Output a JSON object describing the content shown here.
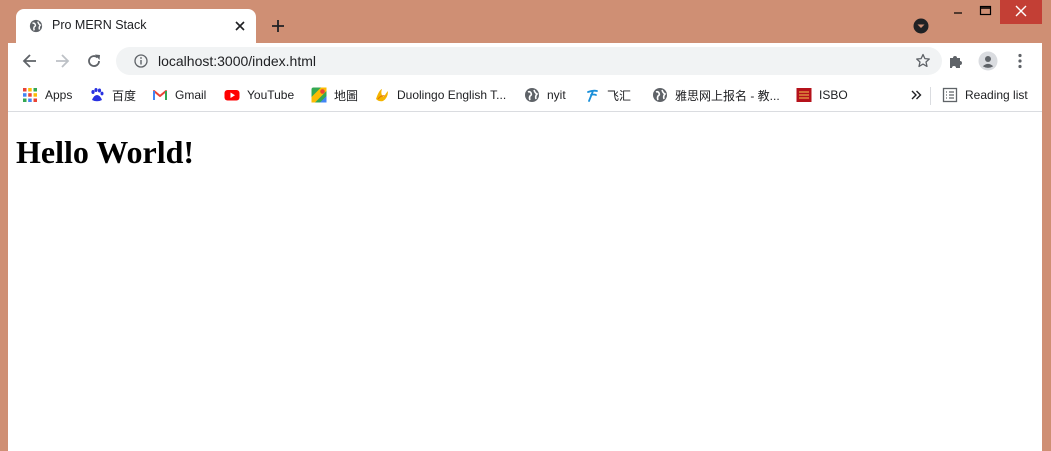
{
  "tab": {
    "title": "Pro MERN Stack"
  },
  "toolbar": {
    "url": "localhost:3000/index.html"
  },
  "bookmarks": [
    {
      "label": "Apps",
      "icon": "apps-grid-icon"
    },
    {
      "label": "百度",
      "icon": "baidu-paw-icon"
    },
    {
      "label": "Gmail",
      "icon": "gmail-icon"
    },
    {
      "label": "YouTube",
      "icon": "youtube-icon"
    },
    {
      "label": "地圖",
      "icon": "maps-icon"
    },
    {
      "label": "Duolingo English T...",
      "icon": "duolingo-icon"
    },
    {
      "label": "nyit",
      "icon": "globe-icon"
    },
    {
      "label": "飞汇",
      "icon": "feihui-icon"
    },
    {
      "label": "雅思网上报名 - 教...",
      "icon": "globe-icon"
    },
    {
      "label": "ISBO",
      "icon": "cibc-icon"
    }
  ],
  "reading_list": {
    "label": "Reading list"
  },
  "page": {
    "heading": "Hello World!"
  },
  "colors": {
    "window_frame": "#cf8f74",
    "close_button": "#c33f35"
  }
}
